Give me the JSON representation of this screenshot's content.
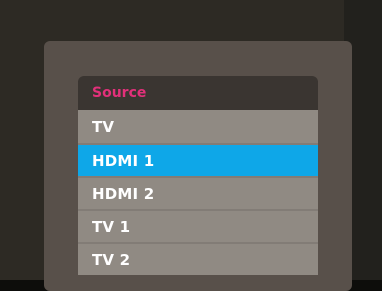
{
  "source_menu": {
    "header": "Source",
    "items": [
      {
        "label": "TV",
        "selected": false
      },
      {
        "label": "HDMI 1",
        "selected": true
      },
      {
        "label": "HDMI 2",
        "selected": false
      },
      {
        "label": "TV 1",
        "selected": false
      },
      {
        "label": "TV 2",
        "selected": false
      }
    ]
  },
  "colors": {
    "header_text": "#e2307a",
    "selected_highlight": "#0ea7e8",
    "item_background": "#908a83",
    "panel_background": "#58504a"
  }
}
